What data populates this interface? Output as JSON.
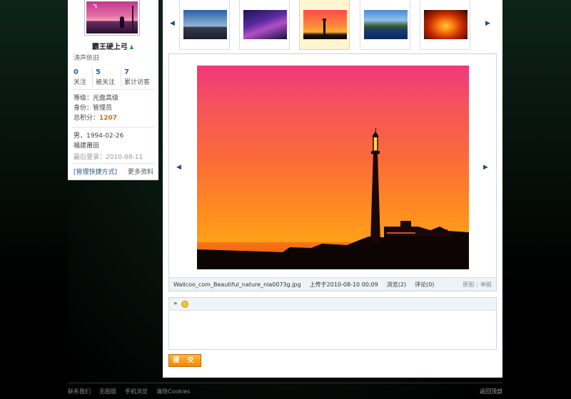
{
  "profile": {
    "username": "霸王硬上弓",
    "motto": "涛声依旧",
    "stats": [
      {
        "value": "0",
        "label": "关注"
      },
      {
        "value": "5",
        "label": "被关注"
      },
      {
        "value": "7",
        "label": "累计访客"
      }
    ],
    "level": "等级：光盘高级",
    "role": "身份：管理员",
    "score_label": "总积分：",
    "score": "1207",
    "gender_birth": "男，1994-02-26",
    "location": "福建莆田",
    "last_login": "最后登录：2010-08-11",
    "manage_link": "[管理快捷方式]",
    "more_link": "更多资料"
  },
  "thumbnails": [
    {
      "name": "rocks-seascape"
    },
    {
      "name": "purple-night-sky"
    },
    {
      "name": "lighthouse-sunset",
      "active": true
    },
    {
      "name": "coastal-lighthouse"
    },
    {
      "name": "orange-sunset"
    }
  ],
  "photo": {
    "filename": "Wallcoo_com_Beautiful_nature_nla0073g.jpg",
    "uploaded": "上传于2010-08-10 00:09",
    "views": "浏览(2)",
    "comments": "评论(0)",
    "original": "原图",
    "report": "举报"
  },
  "comment_box": {
    "submit_label": "提 交"
  },
  "footer": {
    "links": [
      "联系我们",
      "无图版",
      "手机浏览",
      "清除Cookies"
    ],
    "back_to_top": "返回顶部"
  }
}
